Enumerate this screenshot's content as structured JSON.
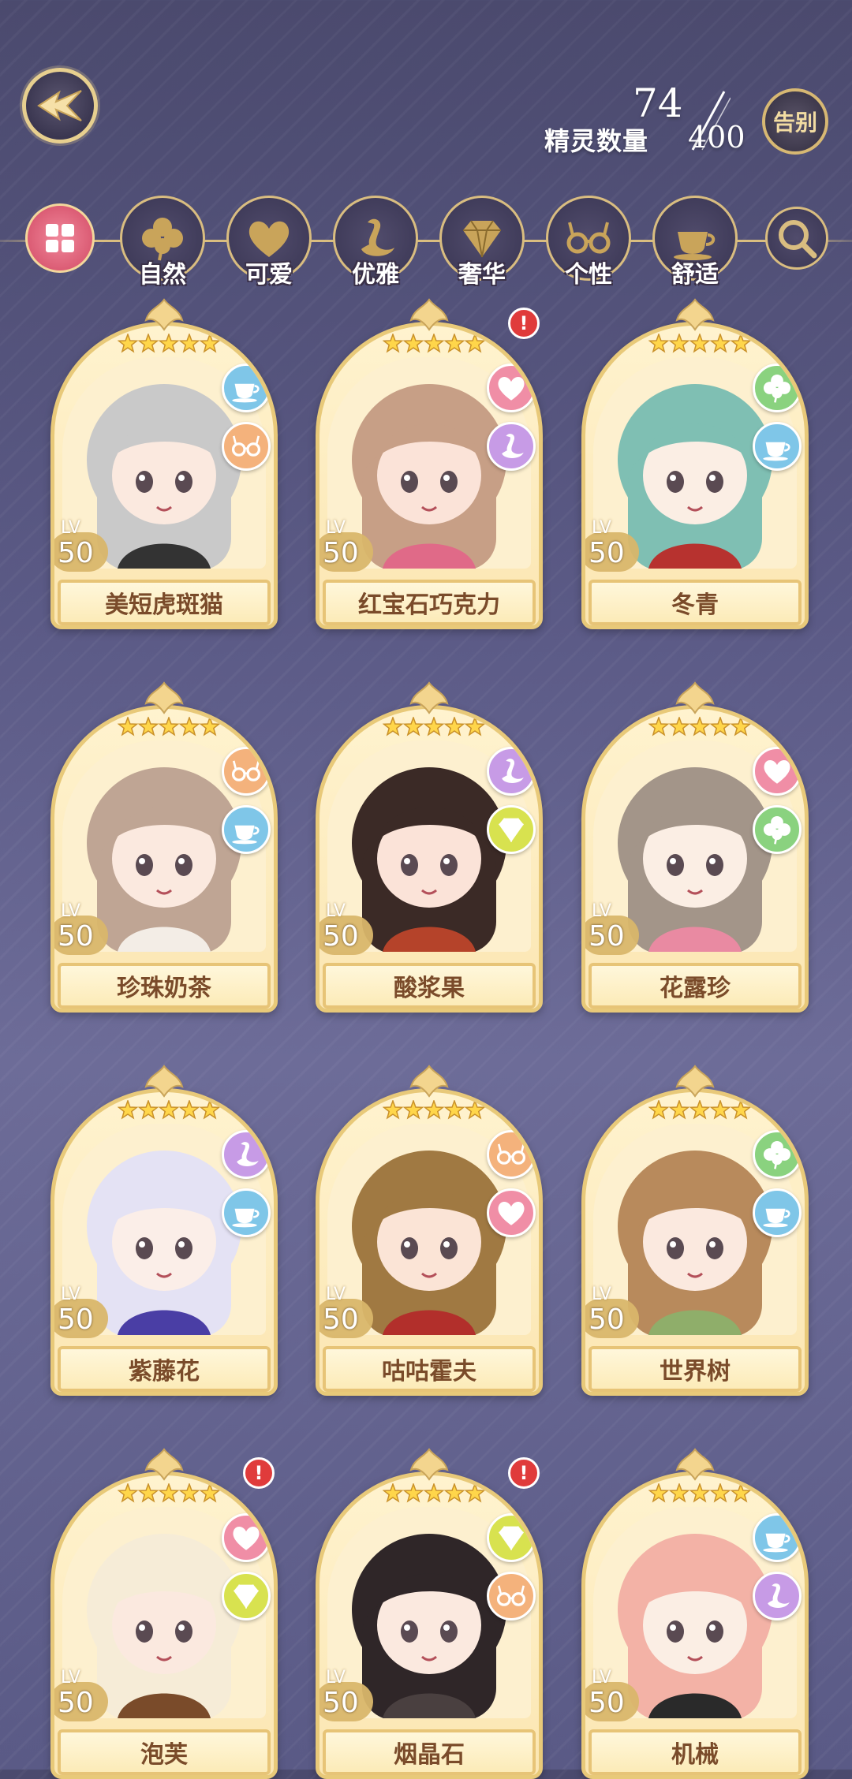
{
  "header": {
    "count_label": "精灵数量",
    "count_current": "74",
    "count_max": "400",
    "farewell_label": "告别"
  },
  "filters": [
    {
      "label": "",
      "icon": "all-icon"
    },
    {
      "label": "自然",
      "icon": "clover-icon"
    },
    {
      "label": "可爱",
      "icon": "heart-icon"
    },
    {
      "label": "优雅",
      "icon": "swan-icon"
    },
    {
      "label": "奢华",
      "icon": "diamond-icon"
    },
    {
      "label": "个性",
      "icon": "glasses-icon"
    },
    {
      "label": "舒适",
      "icon": "teacup-icon"
    },
    {
      "label": "",
      "icon": "search-icon"
    }
  ],
  "spirits": [
    {
      "name": "美短虎斑猫",
      "lv_label": "LV",
      "level": "50",
      "types": [
        "teacup-icon",
        "glasses-icon"
      ],
      "alert": false,
      "alert_text": "",
      "hair": "#c9c9c9",
      "skin": "#fbe9df",
      "accent": "#333333"
    },
    {
      "name": "红宝石巧克力",
      "lv_label": "LV",
      "level": "50",
      "types": [
        "heart-icon",
        "swan-icon"
      ],
      "alert": true,
      "alert_text": "!",
      "hair": "#c79f86",
      "skin": "#fbe3d8",
      "accent": "#e06a88"
    },
    {
      "name": "冬青",
      "lv_label": "LV",
      "level": "50",
      "types": [
        "clover-icon",
        "teacup-icon"
      ],
      "alert": false,
      "alert_text": "",
      "hair": "#7fbfb3",
      "skin": "#fbeee4",
      "accent": "#b7322f"
    },
    {
      "name": "珍珠奶茶",
      "lv_label": "LV",
      "level": "50",
      "types": [
        "glasses-icon",
        "teacup-icon"
      ],
      "alert": false,
      "alert_text": "",
      "hair": "#bfa594",
      "skin": "#fbe9df",
      "accent": "#f3ede6"
    },
    {
      "name": "酸浆果",
      "lv_label": "LV",
      "level": "50",
      "types": [
        "swan-icon",
        "diamond-icon"
      ],
      "alert": false,
      "alert_text": "",
      "hair": "#3b2a26",
      "skin": "#fbe3d8",
      "accent": "#b5432a"
    },
    {
      "name": "花露珍",
      "lv_label": "LV",
      "level": "50",
      "types": [
        "heart-icon",
        "clover-icon"
      ],
      "alert": false,
      "alert_text": "",
      "hair": "#a39589",
      "skin": "#fbeee4",
      "accent": "#e98aa2"
    },
    {
      "name": "紫藤花",
      "lv_label": "LV",
      "level": "50",
      "types": [
        "swan-icon",
        "teacup-icon"
      ],
      "alert": false,
      "alert_text": "",
      "hair": "#e4e2f4",
      "skin": "#fbeee8",
      "accent": "#4a3ea5"
    },
    {
      "name": "咕咕霍夫",
      "lv_label": "LV",
      "level": "50",
      "types": [
        "glasses-icon",
        "heart-icon"
      ],
      "alert": false,
      "alert_text": "",
      "hair": "#a07942",
      "skin": "#fbe4d6",
      "accent": "#b22f2b"
    },
    {
      "name": "世界树",
      "lv_label": "LV",
      "level": "50",
      "types": [
        "clover-icon",
        "teacup-icon"
      ],
      "alert": false,
      "alert_text": "",
      "hair": "#b88a5c",
      "skin": "#fbe9df",
      "accent": "#8fae6a"
    },
    {
      "name": "泡芙",
      "lv_label": "LV",
      "level": "50",
      "types": [
        "heart-icon",
        "diamond-icon"
      ],
      "alert": true,
      "alert_text": "!",
      "hair": "#f6ecd7",
      "skin": "#fbe9df",
      "accent": "#7a4b2a"
    },
    {
      "name": "烟晶石",
      "lv_label": "LV",
      "level": "50",
      "types": [
        "diamond-icon",
        "glasses-icon"
      ],
      "alert": true,
      "alert_text": "!",
      "hair": "#2f2628",
      "skin": "#fbe9df",
      "accent": "#4a4040"
    },
    {
      "name": "机械",
      "lv_label": "LV",
      "level": "50",
      "types": [
        "teacup-icon",
        "swan-icon"
      ],
      "alert": false,
      "alert_text": "",
      "hair": "#f3b2a6",
      "skin": "#fbeee4",
      "accent": "#2a2a2a"
    }
  ],
  "colors": {
    "gold": "#e8c979",
    "card_bg": "#fff3cf",
    "name_text": "#7a4b2a",
    "alert": "#e03b3b"
  }
}
